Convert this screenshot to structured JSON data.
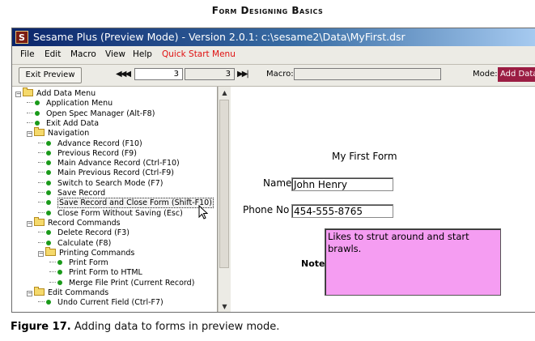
{
  "page_heading": "Form Designing Basics",
  "window": {
    "title": "Sesame Plus (Preview Mode) - Version 2.0.1: c:\\sesame2\\Data\\MyFirst.dsr",
    "icon_letter": "S"
  },
  "menu": {
    "file": "File",
    "edit": "Edit",
    "macro": "Macro",
    "view": "View",
    "help": "Help",
    "quick_start": "Quick Start Menu"
  },
  "toolbar": {
    "exit_preview": "Exit Preview",
    "first_prev": "◀◀◀",
    "current_record": "3",
    "record_count": "3",
    "next_last": "▶▶|",
    "macro_label": "Macro:",
    "macro_value": "",
    "mode_label": "Mode:",
    "mode_value": "Add Data"
  },
  "tree": {
    "items": [
      {
        "label": "Add Data Menu",
        "type": "folder",
        "level": 0
      },
      {
        "label": "Application Menu",
        "type": "item",
        "level": 1
      },
      {
        "label": "Open Spec Manager (Alt-F8)",
        "type": "item",
        "level": 1
      },
      {
        "label": "Exit Add Data",
        "type": "item",
        "level": 1
      },
      {
        "label": "Navigation",
        "type": "folder",
        "level": 1
      },
      {
        "label": "Advance Record (F10)",
        "type": "item",
        "level": 2
      },
      {
        "label": "Previous Record (F9)",
        "type": "item",
        "level": 2
      },
      {
        "label": "Main Advance Record (Ctrl-F10)",
        "type": "item",
        "level": 2
      },
      {
        "label": "Main Previous Record (Ctrl-F9)",
        "type": "item",
        "level": 2
      },
      {
        "label": "Switch to Search Mode (F7)",
        "type": "item",
        "level": 2
      },
      {
        "label": "Save Record",
        "type": "item",
        "level": 2
      },
      {
        "label": "Save Record and Close Form (Shift-F10)",
        "type": "item",
        "level": 2,
        "selected": true
      },
      {
        "label": "Close Form Without Saving (Esc)",
        "type": "item",
        "level": 2
      },
      {
        "label": "Record Commands",
        "type": "folder",
        "level": 1
      },
      {
        "label": "Delete Record (F3)",
        "type": "item",
        "level": 2
      },
      {
        "label": "Calculate (F8)",
        "type": "item",
        "level": 2
      },
      {
        "label": "Printing Commands",
        "type": "folder",
        "level": 2
      },
      {
        "label": "Print Form",
        "type": "item",
        "level": 3
      },
      {
        "label": "Print Form to HTML",
        "type": "item",
        "level": 3
      },
      {
        "label": "Merge File Print (Current Record)",
        "type": "item",
        "level": 3
      },
      {
        "label": "Edit Commands",
        "type": "folder",
        "level": 1
      },
      {
        "label": "Undo Current Field (Ctrl-F7)",
        "type": "item",
        "level": 2
      }
    ]
  },
  "form": {
    "title": "My First Form",
    "name_label": "Name",
    "name_value": "John Henry",
    "phone_label": "Phone No",
    "phone_value": "454-555-8765",
    "notes_label": "Notes",
    "notes_value": "Likes to strut around and start brawls."
  },
  "caption": {
    "figure": "Figure 17.",
    "text": " Adding data to forms in preview mode."
  },
  "colors": {
    "title_bar": "#0a246a",
    "mode_badge": "#9b1d43",
    "notes_background": "#f59df2",
    "tree_bullet": "#1a9a1a",
    "quick_start_menu": "#e01010"
  }
}
